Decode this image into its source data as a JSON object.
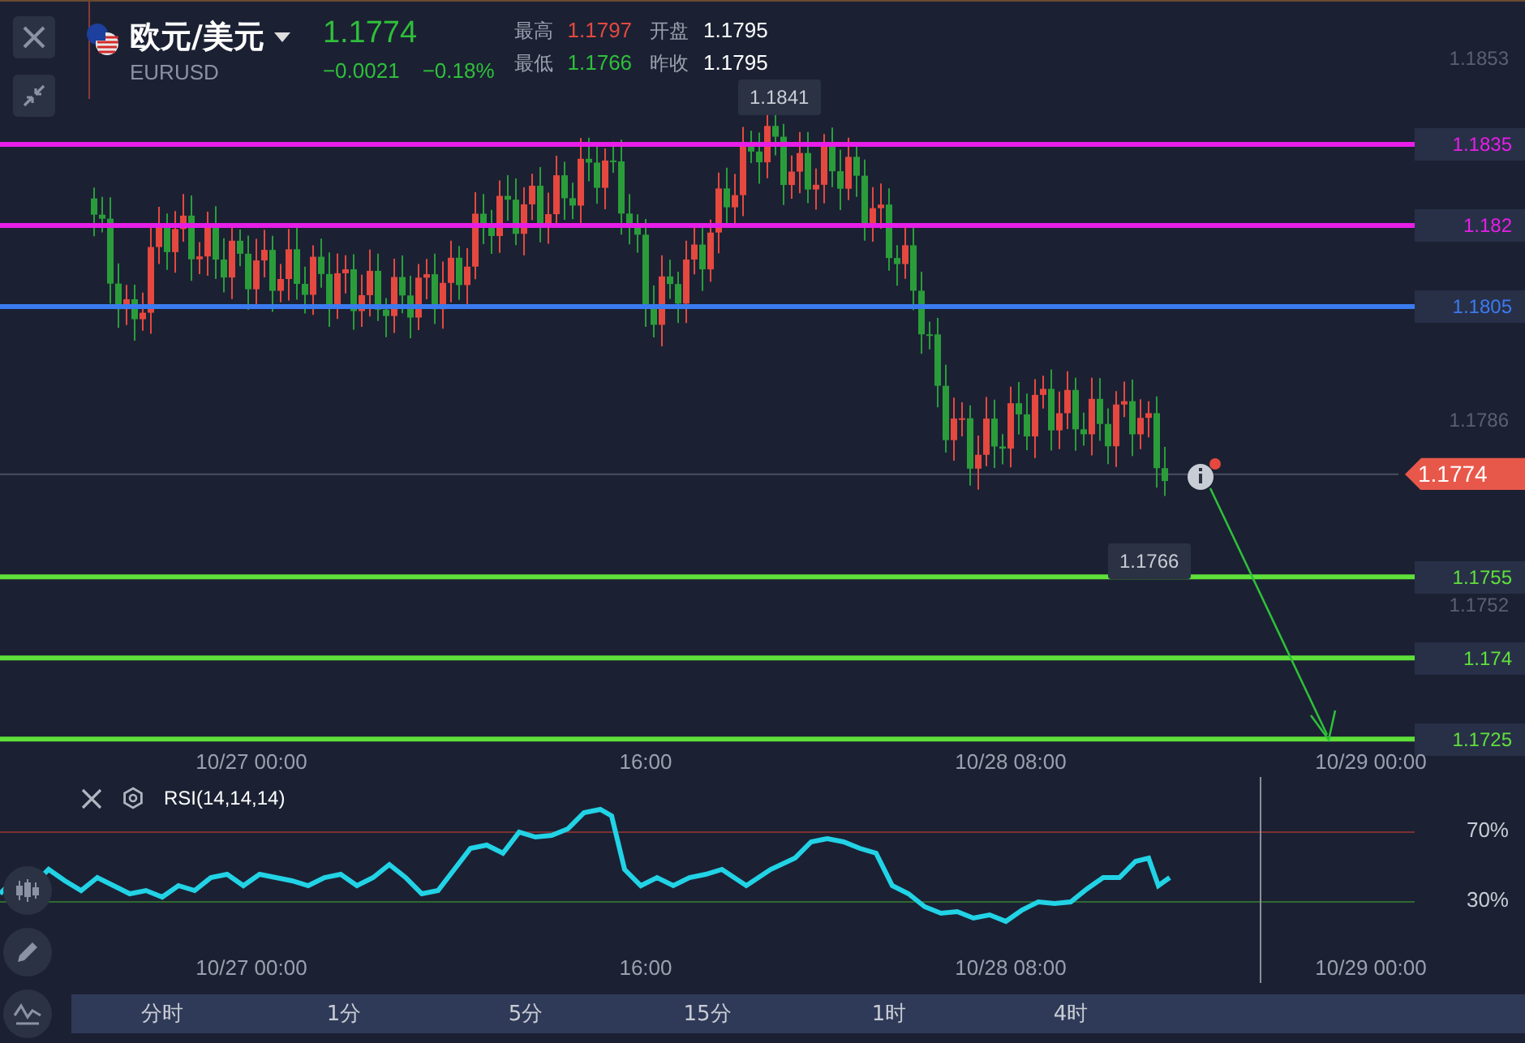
{
  "header": {
    "symbol": "欧元/美元",
    "code": "EURUSD",
    "price": "1.1774",
    "change": "−0.0021",
    "change_pct": "−0.18%",
    "stats": [
      {
        "label": "最高",
        "value": "1.1797",
        "color": "#e5483f"
      },
      {
        "label": "开盘",
        "value": "1.1795",
        "color": "#ffffff"
      },
      {
        "label": "最低",
        "value": "1.1766",
        "color": "#2fbf3a"
      },
      {
        "label": "昨收",
        "value": "1.1795",
        "color": "#ffffff"
      }
    ]
  },
  "chart": {
    "price_ticks": [
      "1.1853",
      "1.1786",
      "1.1752"
    ],
    "price_lines": [
      {
        "label": "1.1835",
        "color": "#e81ee8"
      },
      {
        "label": "1.182",
        "color": "#e81ee8"
      },
      {
        "label": "1.1805",
        "color": "#3a7bf0"
      },
      {
        "label": "1.1755",
        "color": "#5fe03a"
      },
      {
        "label": "1.174",
        "color": "#5fe03a"
      },
      {
        "label": "1.1725",
        "color": "#5fe03a"
      }
    ],
    "current_price": "1.1774",
    "high_marker": "1.1841",
    "low_marker": "1.1766",
    "time_axis": [
      "10/27 00:00",
      "16:00",
      "10/28 08:00",
      "10/29 00:00"
    ]
  },
  "indicator": {
    "name": "RSI(14,14,14)",
    "levels": [
      "70%",
      "30%"
    ],
    "time_axis": [
      "10/27 00:00",
      "16:00",
      "10/28 08:00",
      "10/29 00:00"
    ]
  },
  "periods": [
    {
      "label": "分时",
      "selected": false
    },
    {
      "label": "1分",
      "selected": false
    },
    {
      "label": "5分",
      "selected": false
    },
    {
      "label": "15分",
      "selected": false
    },
    {
      "label": "1时",
      "selected": false
    },
    {
      "label": "4时",
      "selected": false
    }
  ]
}
